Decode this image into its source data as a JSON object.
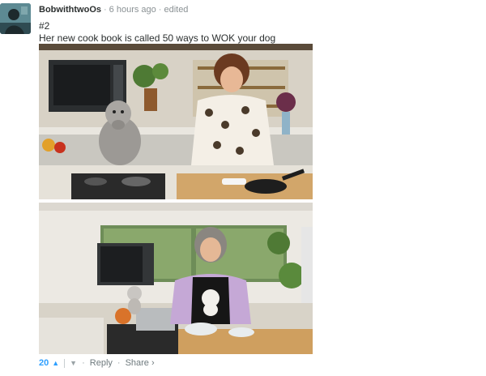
{
  "comment": {
    "author": "BobwithtwoOs",
    "time_ago": "6 hours ago",
    "edited_label": "edited",
    "line1": "#2",
    "line2": "Her new cook book is called 50 ways to WOK your dog"
  },
  "footer": {
    "vote_count": "20",
    "upvote_icon": "chevron-up-icon",
    "downvote_icon": "chevron-down-icon",
    "reply_label": "Reply",
    "share_label": "Share ›"
  },
  "colors": {
    "accent": "#2e9fff",
    "meta_text": "#8a9194",
    "body_text": "#2a2e2e"
  }
}
